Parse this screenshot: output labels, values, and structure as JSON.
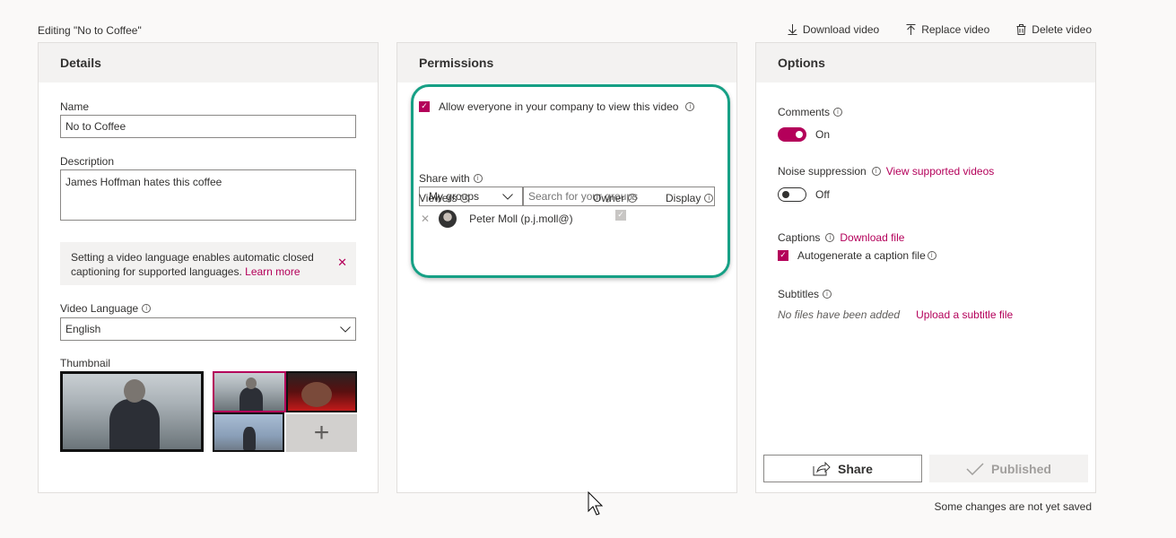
{
  "page": {
    "editing_title": "Editing \"No to Coffee\"",
    "save_status": "Some changes are not yet saved"
  },
  "top_actions": {
    "download": "Download video",
    "replace": "Replace video",
    "delete": "Delete video"
  },
  "details": {
    "header": "Details",
    "name_label": "Name",
    "name_value": "No to Coffee",
    "description_label": "Description",
    "description_value": "James Hoffman hates this coffee",
    "notice_text": "Setting a video language enables automatic closed captioning for supported languages.",
    "notice_link": "Learn more",
    "language_label": "Video Language",
    "language_value": "English",
    "thumbnail_label": "Thumbnail"
  },
  "permissions": {
    "header": "Permissions",
    "allow_label": "Allow everyone in your company to view this video",
    "share_with_label": "Share with",
    "groups_value": "My groups",
    "search_placeholder": "Search for your groups",
    "viewers_label": "Viewers",
    "owner_label": "Owner",
    "display_label": "Display",
    "viewer_name": "Peter Moll (p.j.moll@)"
  },
  "options": {
    "header": "Options",
    "comments_label": "Comments",
    "comments_state": "On",
    "noise_label": "Noise suppression",
    "noise_link": "View supported videos",
    "noise_state": "Off",
    "captions_label": "Captions",
    "captions_link": "Download file",
    "autogenerate_label": "Autogenerate a caption file",
    "subtitles_label": "Subtitles",
    "subtitles_empty": "No files have been added",
    "subtitles_link": "Upload a subtitle file",
    "share_button": "Share",
    "published_button": "Published"
  },
  "colors": {
    "accent": "#b4005a",
    "highlight": "#16a085"
  }
}
